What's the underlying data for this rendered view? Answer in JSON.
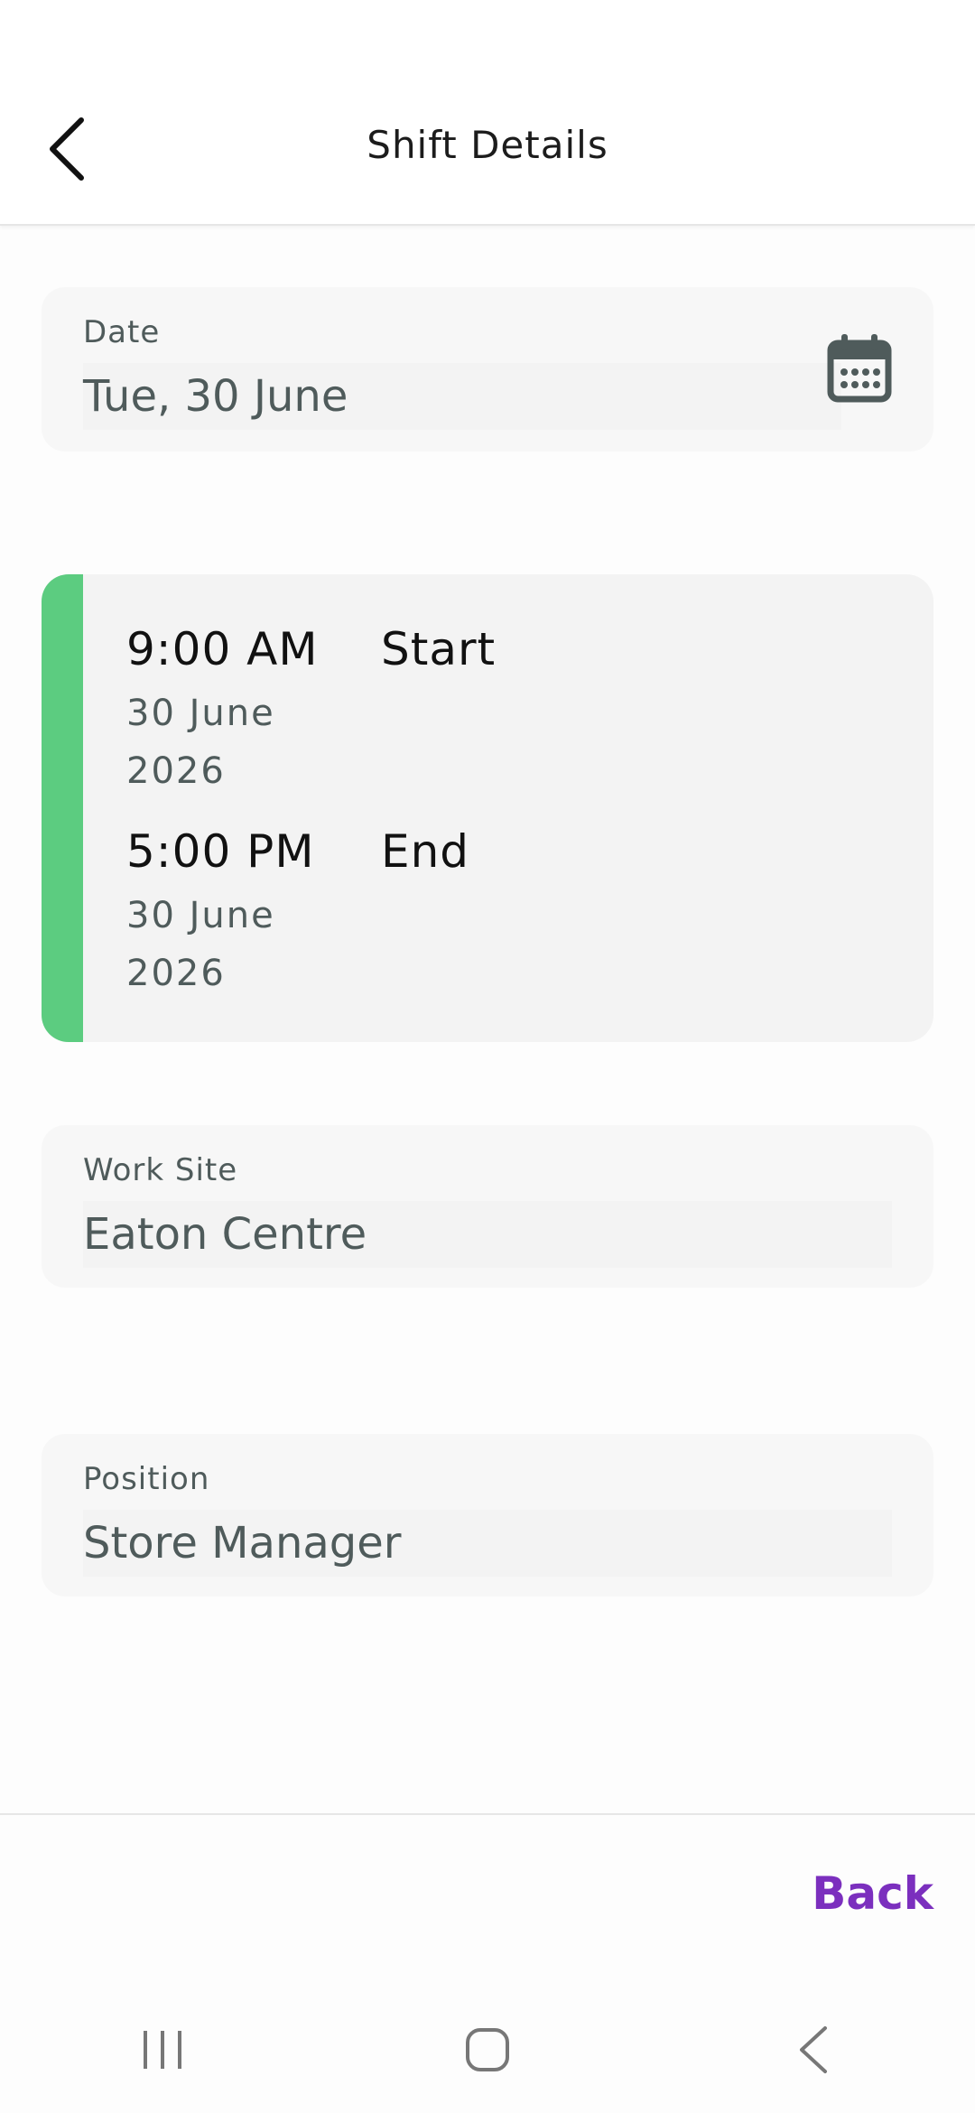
{
  "header": {
    "title": "Shift Details"
  },
  "date_field": {
    "label": "Date",
    "value": "Tue, 30 June"
  },
  "shift": {
    "accent_color": "#5ccc80",
    "start": {
      "time": "9:00 AM",
      "label": "Start",
      "date": "30 June 2026"
    },
    "end": {
      "time": "5:00 PM",
      "label": "End",
      "date": "30 June 2026"
    }
  },
  "work_site": {
    "label": "Work Site",
    "value": "Eaton Centre"
  },
  "position": {
    "label": "Position",
    "value": "Store Manager"
  },
  "footer": {
    "back_label": "Back",
    "accent_color": "#7b2fbe"
  },
  "icons": {
    "back": "chevron-left-icon",
    "calendar": "calendar-icon",
    "recents": "recent-apps-icon",
    "home": "home-icon",
    "nav_back": "back-icon"
  }
}
